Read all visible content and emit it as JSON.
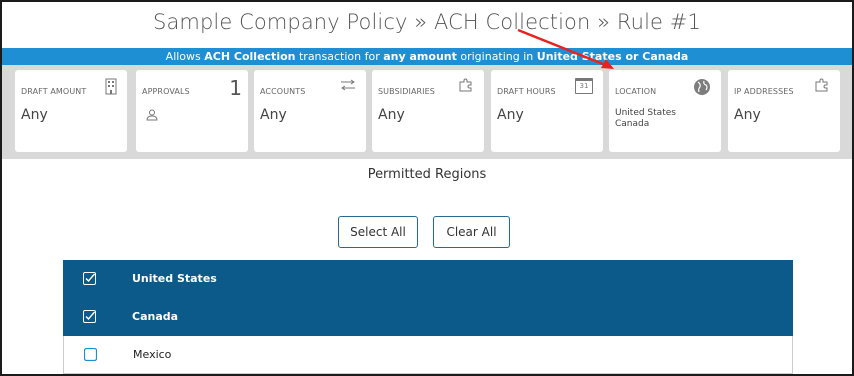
{
  "header": {
    "title": "Sample Company Policy » ACH Collection » Rule #1"
  },
  "banner": {
    "prefix": "Allows",
    "transaction": "ACH Collection",
    "mid1": "transaction for",
    "amount": "any amount",
    "mid2": "originating in",
    "regions": "United States or Canada"
  },
  "tiles": [
    {
      "label": "DRAFT AMOUNT",
      "value": "Any",
      "icon": "building-icon"
    },
    {
      "label": "APPROVALS",
      "count": "1",
      "icon": "user-icon"
    },
    {
      "label": "ACCOUNTS",
      "value": "Any",
      "icon": "transfer-arrows-icon"
    },
    {
      "label": "SUBSIDIARIES",
      "value": "Any",
      "icon": "puzzle-icon"
    },
    {
      "label": "DRAFT HOURS",
      "value": "Any",
      "icon": "calendar-icon",
      "icon_text": "31"
    },
    {
      "label": "LOCATION",
      "value_line1": "United States",
      "value_line2": "Canada",
      "icon": "globe-icon"
    },
    {
      "label": "IP ADDRESSES",
      "value": "Any",
      "icon": "puzzle-icon"
    }
  ],
  "regions": {
    "title": "Permitted Regions",
    "select_all": "Select All",
    "clear_all": "Clear All",
    "items": [
      {
        "name": "United States",
        "checked": true
      },
      {
        "name": "Canada",
        "checked": true
      },
      {
        "name": "Mexico",
        "checked": false
      }
    ]
  },
  "colors": {
    "banner": "#1e8fd3",
    "selected_row": "#0b5a8a",
    "annotation_arrow": "#e8231f"
  }
}
